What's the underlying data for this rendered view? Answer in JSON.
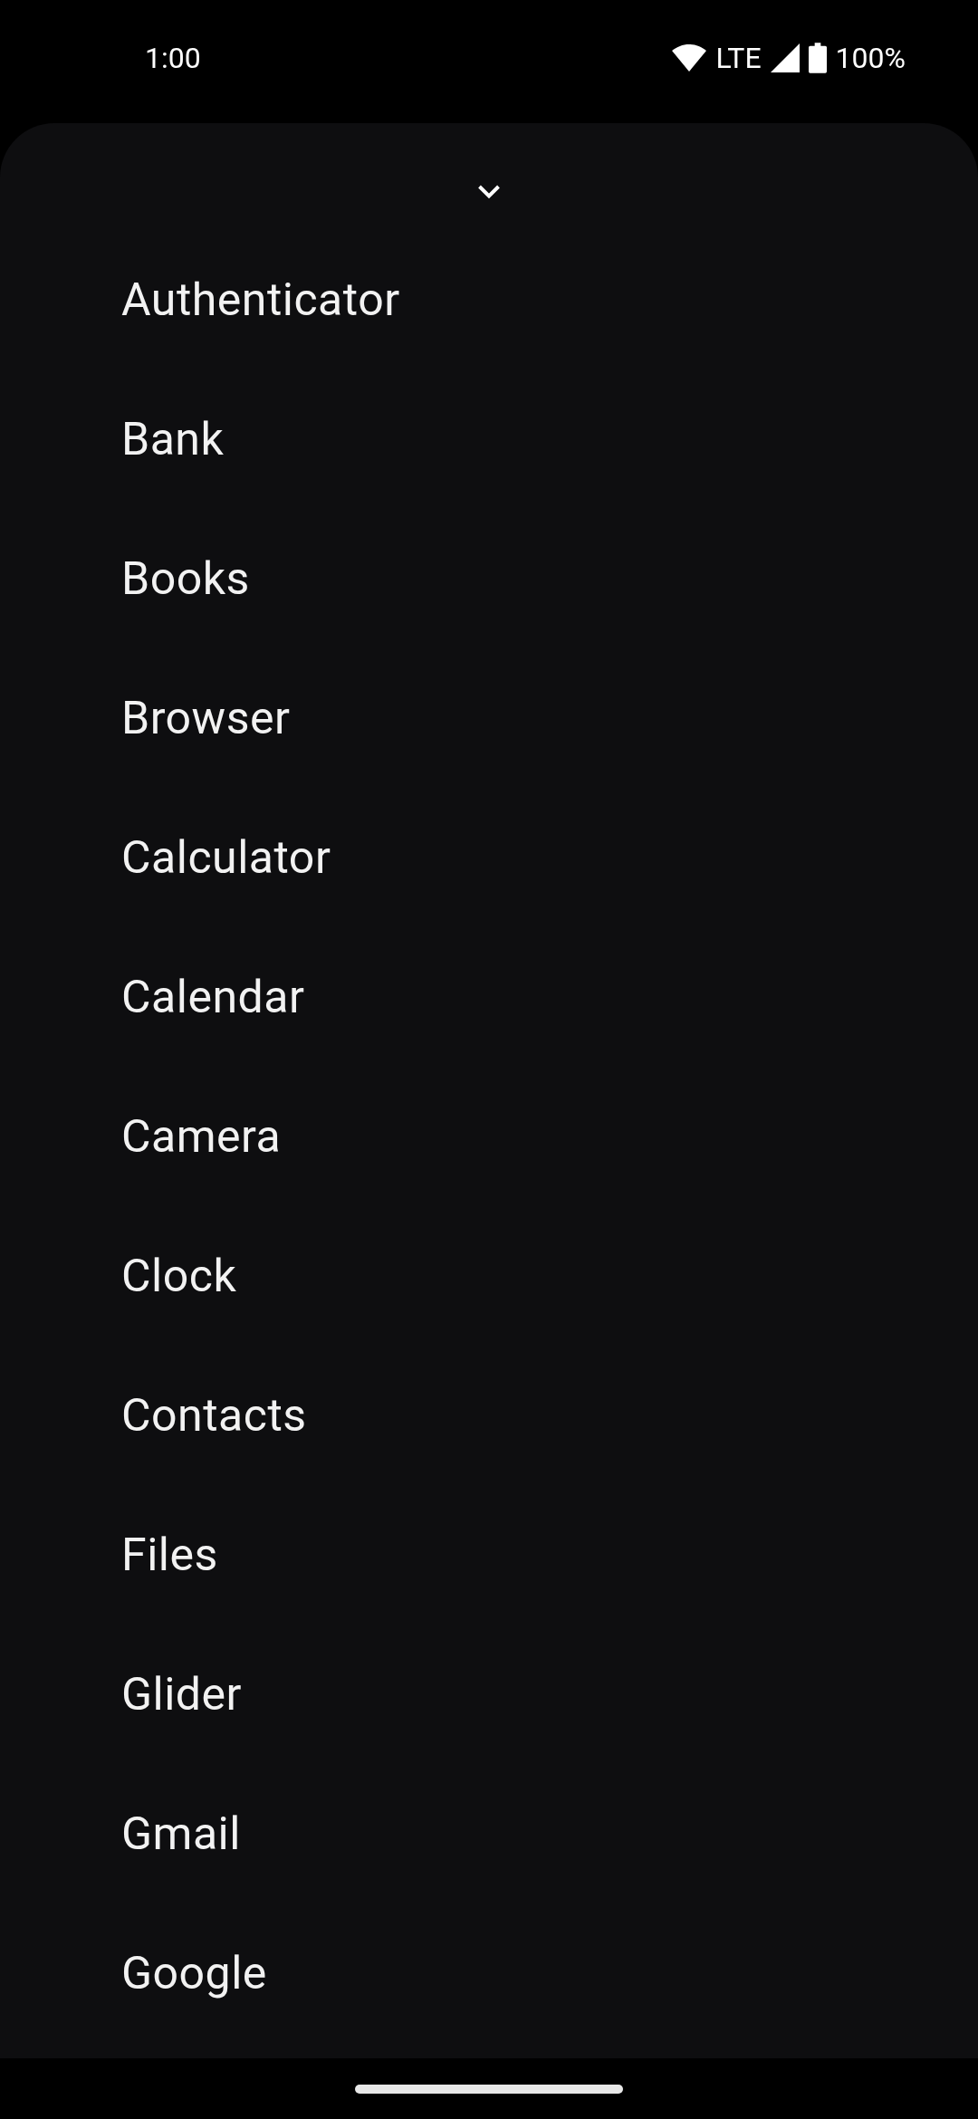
{
  "status_bar": {
    "time": "1:00",
    "network": "LTE",
    "battery": "100%"
  },
  "app_list": [
    {
      "label": "Authenticator"
    },
    {
      "label": "Bank"
    },
    {
      "label": "Books"
    },
    {
      "label": "Browser"
    },
    {
      "label": "Calculator"
    },
    {
      "label": "Calendar"
    },
    {
      "label": "Camera"
    },
    {
      "label": "Clock"
    },
    {
      "label": "Contacts"
    },
    {
      "label": "Files"
    },
    {
      "label": "Glider"
    },
    {
      "label": "Gmail"
    },
    {
      "label": "Google"
    }
  ]
}
